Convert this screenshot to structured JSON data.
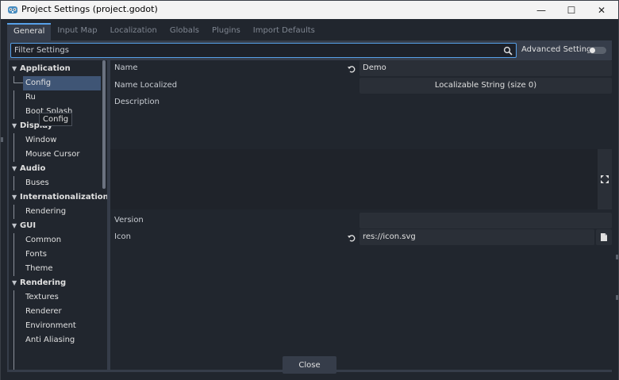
{
  "window": {
    "title": "Project Settings (project.godot)",
    "controls": {
      "minimize": "—",
      "maximize": "☐",
      "close": "✕"
    }
  },
  "tabs": [
    {
      "label": "General",
      "active": true
    },
    {
      "label": "Input Map",
      "active": false
    },
    {
      "label": "Localization",
      "active": false
    },
    {
      "label": "Globals",
      "active": false
    },
    {
      "label": "Plugins",
      "active": false
    },
    {
      "label": "Import Defaults",
      "active": false
    }
  ],
  "filter": {
    "placeholder": "Filter Settings",
    "icon": "search-icon"
  },
  "advanced": {
    "label": "Advanced Settings",
    "enabled": false
  },
  "tree": {
    "application": "Application",
    "config": "Config",
    "run_partial": "Ru",
    "boot_splash": "Boot Splash",
    "display": "Display",
    "window": "Window",
    "mouse_cursor": "Mouse Cursor",
    "audio": "Audio",
    "buses": "Buses",
    "internationalization": "Internationalization",
    "i18n_rendering": "Rendering",
    "gui": "GUI",
    "common": "Common",
    "fonts": "Fonts",
    "theme": "Theme",
    "rendering": "Rendering",
    "textures": "Textures",
    "renderer": "Renderer",
    "environment": "Environment",
    "anti_aliasing": "Anti Aliasing"
  },
  "tooltip": {
    "text": "Config"
  },
  "inspector": {
    "name_label": "Name",
    "name_value": "Demo",
    "name_localized_label": "Name Localized",
    "name_localized_value": "Localizable String (size 0)",
    "description_label": "Description",
    "version_label": "Version",
    "version_value": "",
    "icon_label": "Icon",
    "icon_value": "res://icon.svg"
  },
  "footer": {
    "close_label": "Close"
  },
  "colors": {
    "accent": "#56a0e8",
    "background": "#21262e",
    "panel": "#363d4a",
    "selection": "#3f5575",
    "text": "#e0e0e0"
  }
}
